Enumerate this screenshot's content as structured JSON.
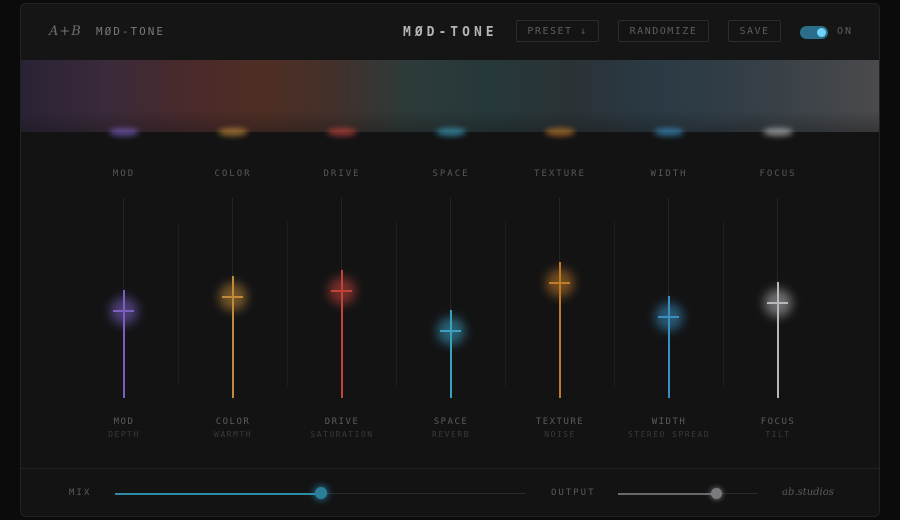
{
  "header": {
    "logo_mark": "A+B",
    "logo_name": "MØD-TONE",
    "title": "MØD-TONE",
    "preset_label": "PRESET ↓",
    "randomize_label": "RANDOMIZE",
    "save_label": "SAVE",
    "power_label": "ON",
    "power_on": true
  },
  "channels": [
    {
      "top_label": "MOD",
      "name": "MOD",
      "sub": "DEPTH",
      "value": 0.44,
      "color": "#7a5fc0"
    },
    {
      "top_label": "COLOR",
      "name": "COLOR",
      "sub": "WARMTH",
      "value": 0.51,
      "color": "#c08a3a"
    },
    {
      "top_label": "DRIVE",
      "name": "DRIVE",
      "sub": "SATURATION",
      "value": 0.54,
      "color": "#c0443a"
    },
    {
      "top_label": "SPACE",
      "name": "SPACE",
      "sub": "REVERB",
      "value": 0.34,
      "color": "#3aa0c0"
    },
    {
      "top_label": "TEXTURE",
      "name": "TEXTURE",
      "sub": "NOISE",
      "value": 0.58,
      "color": "#c07a2a"
    },
    {
      "top_label": "WIDTH",
      "name": "WIDTH",
      "sub": "STEREO SPREAD",
      "value": 0.41,
      "color": "#3a8fc0"
    },
    {
      "top_label": "FOCUS",
      "name": "FOCUS",
      "sub": "TILT",
      "value": 0.48,
      "color": "#b8b8bb"
    }
  ],
  "footer": {
    "mix_label": "MIX",
    "mix_value": 0.5,
    "output_label": "OUTPUT",
    "output_value": 0.7,
    "brand": "ab.studios"
  },
  "colors": {
    "accent": "#3aa0c0",
    "background": "#131314"
  }
}
